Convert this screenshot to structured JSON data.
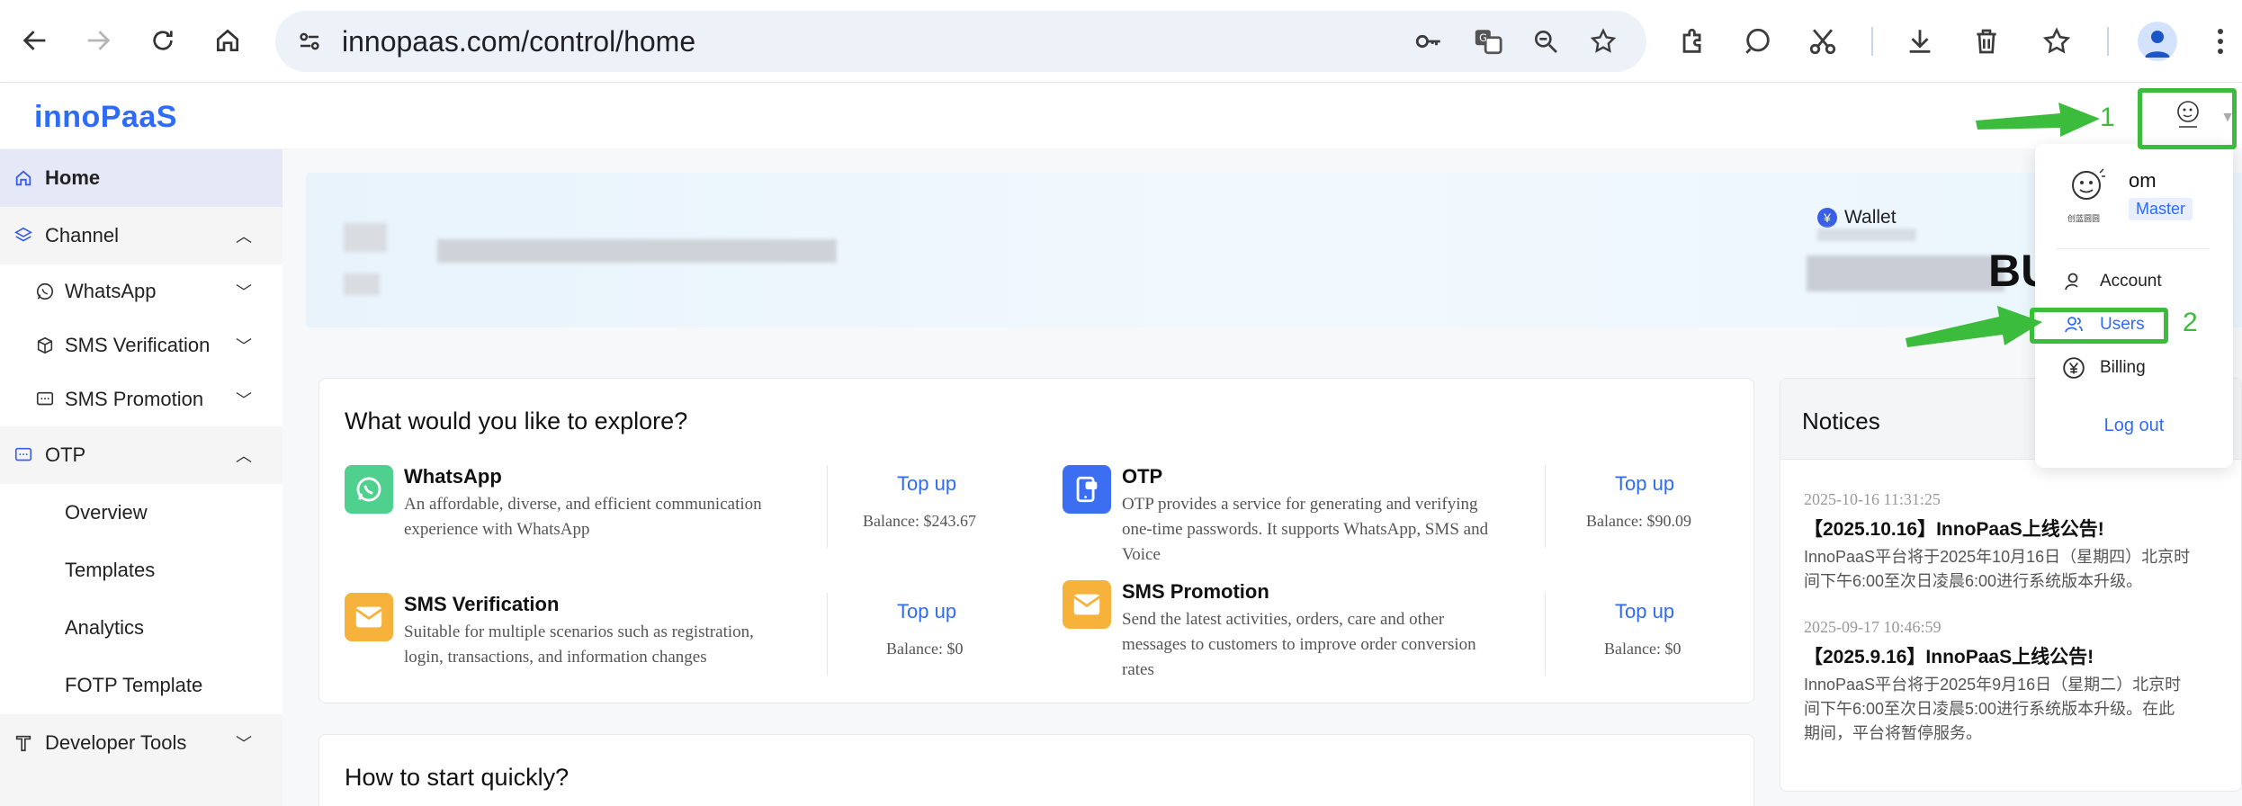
{
  "browser": {
    "url": "innopaas.com/control/home"
  },
  "app": {
    "logo_text": "innoPaaS"
  },
  "sidebar": {
    "items": [
      {
        "label": "Home",
        "icon": "home-icon",
        "active": true
      },
      {
        "label": "Channel",
        "icon": "layers-icon",
        "chevron": "up"
      },
      {
        "label": "WhatsApp",
        "icon": "whatsapp-icon",
        "chevron": "down"
      },
      {
        "label": "SMS Verification",
        "icon": "cube-icon",
        "chevron": "down"
      },
      {
        "label": "SMS Promotion",
        "icon": "chat-icon",
        "chevron": "down"
      },
      {
        "label": "OTP",
        "icon": "message-icon",
        "chevron": "up"
      },
      {
        "label": "Overview"
      },
      {
        "label": "Templates"
      },
      {
        "label": "Analytics"
      },
      {
        "label": "FOTP Template"
      },
      {
        "label": "Developer Tools",
        "icon": "tools-icon",
        "chevron": "down"
      }
    ]
  },
  "banner": {
    "wallet_label": "Wallet",
    "wallet_text": "BUS"
  },
  "explore": {
    "title": "What would you like to explore?",
    "services": [
      {
        "name": "WhatsApp",
        "desc": "An affordable, diverse, and efficient communication experience with WhatsApp",
        "topup": "Top up",
        "balance": "Balance: $243.67"
      },
      {
        "name": "OTP",
        "desc": "OTP provides a service for generating and verifying one-time passwords. It supports WhatsApp, SMS and Voice",
        "topup": "Top up",
        "balance": "Balance: $90.09"
      },
      {
        "name": "SMS Verification",
        "desc": "Suitable for multiple scenarios such as registration, login, transactions, and information changes",
        "topup": "Top up",
        "balance": "Balance: $0"
      },
      {
        "name": "SMS Promotion",
        "desc": "Send the latest activities, orders, care and other messages to customers to improve order conversion rates",
        "topup": "Top up",
        "balance": "Balance: $0"
      }
    ]
  },
  "howto": {
    "title": "How to start quickly?"
  },
  "notices": {
    "title": "Notices",
    "items": [
      {
        "time": "2025-10-16 11:31:25",
        "title": "【2025.10.16】InnoPaaS上线公告!",
        "body": "InnoPaaS平台将于2025年10月16日（星期四）北京时间下午6:00至次日凌晨6:00进行系统版本升级。"
      },
      {
        "time": "2025-09-17 10:46:59",
        "title": "【2025.9.16】InnoPaaS上线公告!",
        "body": "InnoPaaS平台将于2025年9月16日（星期二）北京时间下午6:00至次日凌晨5:00进行系统版本升级。在此期间，平台将暂停服务。"
      }
    ]
  },
  "user_menu": {
    "name": "om",
    "role": "Master",
    "avatar_caption": "创蓝圆圆",
    "items": [
      {
        "label": "Account",
        "icon": "account-icon"
      },
      {
        "label": "Users",
        "icon": "users-icon"
      },
      {
        "label": "Billing",
        "icon": "yen-icon"
      }
    ],
    "logout": "Log out"
  },
  "annotations": {
    "step1": "1",
    "step2": "2",
    "color": "#3cbc3c"
  }
}
